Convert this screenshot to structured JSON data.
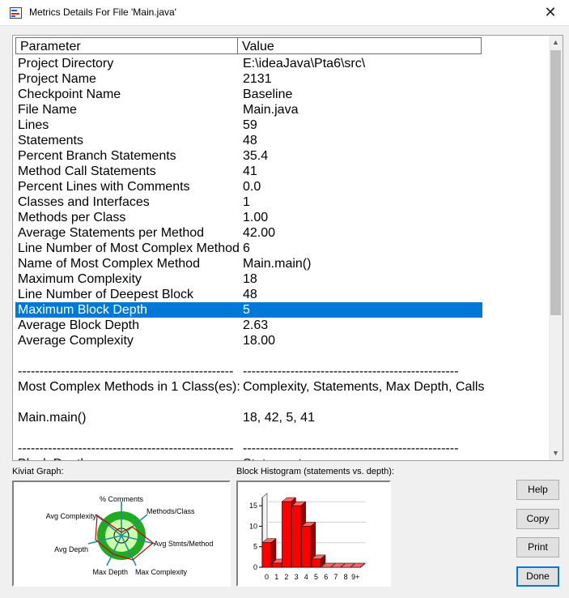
{
  "window": {
    "title": "Metrics Details For File 'Main.java'",
    "close_glyph": "✕",
    "title_icon": "app-icon"
  },
  "table": {
    "headers": {
      "parameter": "Parameter",
      "value": "Value"
    },
    "rows": [
      {
        "param": "Project Directory",
        "value": "E:\\ideaJava\\Pta6\\src\\",
        "selected": false
      },
      {
        "param": "Project Name",
        "value": "2131",
        "selected": false
      },
      {
        "param": "Checkpoint Name",
        "value": "Baseline",
        "selected": false
      },
      {
        "param": "File Name",
        "value": "Main.java",
        "selected": false
      },
      {
        "param": "Lines",
        "value": "59",
        "selected": false
      },
      {
        "param": "Statements",
        "value": "48",
        "selected": false
      },
      {
        "param": "Percent Branch Statements",
        "value": "35.4",
        "selected": false
      },
      {
        "param": "Method Call Statements",
        "value": "41",
        "selected": false
      },
      {
        "param": "Percent Lines with Comments",
        "value": "0.0",
        "selected": false
      },
      {
        "param": "Classes and Interfaces",
        "value": "1",
        "selected": false
      },
      {
        "param": "Methods per Class",
        "value": "1.00",
        "selected": false
      },
      {
        "param": "Average Statements per Method",
        "value": "42.00",
        "selected": false
      },
      {
        "param": "Line Number of Most Complex Method",
        "value": "6",
        "selected": false
      },
      {
        "param": "Name of Most Complex Method",
        "value": "Main.main()",
        "selected": false
      },
      {
        "param": "Maximum Complexity",
        "value": "18",
        "selected": false
      },
      {
        "param": "Line Number of Deepest Block",
        "value": "48",
        "selected": false
      },
      {
        "param": "Maximum Block Depth",
        "value": "5",
        "selected": true
      },
      {
        "param": "Average Block Depth",
        "value": "2.63",
        "selected": false
      },
      {
        "param": "Average Complexity",
        "value": "18.00",
        "selected": false
      },
      {
        "param": "",
        "value": "",
        "selected": false
      },
      {
        "param": "--------------------------------------------------",
        "value": "--------------------------------------------------",
        "selected": false
      },
      {
        "param": "Most Complex Methods in 1 Class(es):",
        "value": "Complexity, Statements, Max Depth, Calls",
        "selected": false
      },
      {
        "param": "",
        "value": "",
        "selected": false
      },
      {
        "param": "Main.main()",
        "value": "18, 42, 5, 41",
        "selected": false
      },
      {
        "param": "",
        "value": "",
        "selected": false
      },
      {
        "param": "--------------------------------------------------",
        "value": "--------------------------------------------------",
        "selected": false
      },
      {
        "param": "Block Depth",
        "value": "Statements",
        "selected": false
      }
    ]
  },
  "scrollbar": {
    "up_glyph": "▲",
    "down_glyph": "▼"
  },
  "kiviat": {
    "caption": "Kiviat Graph:",
    "labels": {
      "comments": "% Comments",
      "methods_class": "Methods/Class",
      "avg_stmts": "Avg Stmts/Method",
      "max_complexity": "Max Complexity",
      "max_depth": "Max Depth",
      "avg_depth": "Avg Depth",
      "avg_complexity": "Avg Complexity"
    }
  },
  "histogram": {
    "caption": "Block Histogram (statements vs. depth):",
    "y_ticks": [
      "0",
      "5",
      "10",
      "15"
    ],
    "categories": [
      "0",
      "1",
      "2",
      "3",
      "4",
      "5",
      "6",
      "7",
      "8",
      "9+"
    ],
    "values": [
      6,
      1,
      16,
      15,
      10,
      2,
      0,
      0,
      0,
      0
    ],
    "ymax": 17,
    "color": "#ff0000"
  },
  "buttons": {
    "help": "Help",
    "copy": "Copy",
    "print": "Print",
    "done": "Done"
  }
}
